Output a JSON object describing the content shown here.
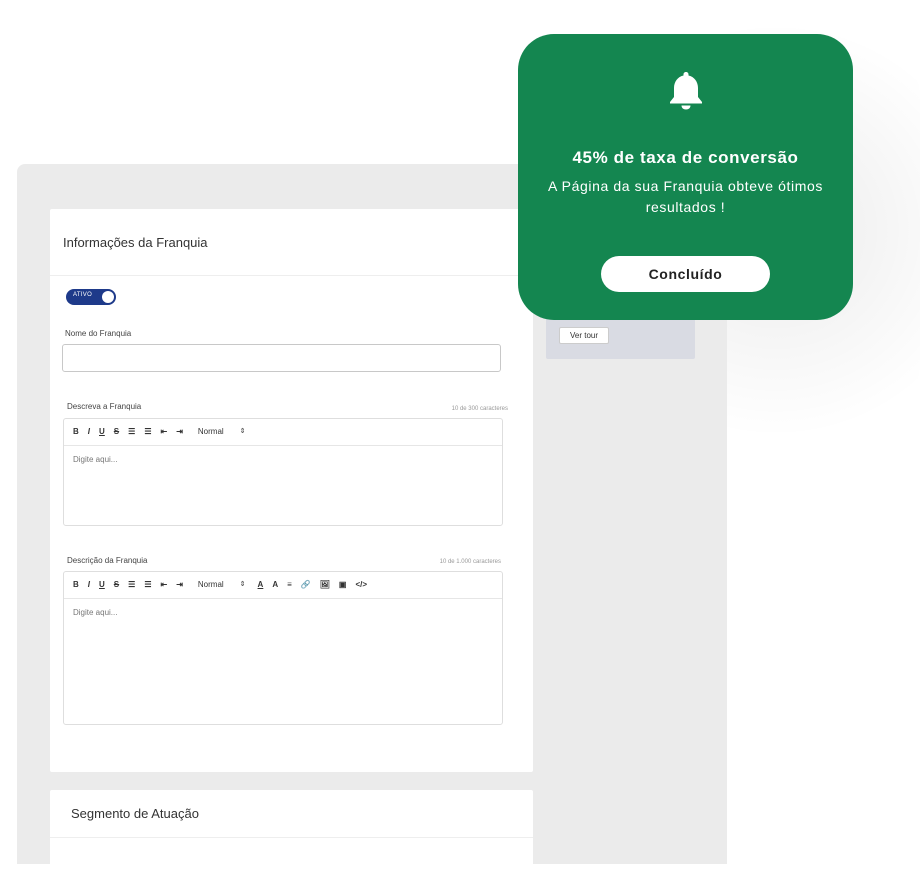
{
  "popup": {
    "title": "45% de taxa de conversão",
    "message": "A Página da sua Franquia obteve ótimos resultados !",
    "button": "Concluído",
    "icon": "bell-icon",
    "bg_color": "#148650"
  },
  "section": {
    "title": "Informações da Franquia",
    "toggle_label": "ATIVO"
  },
  "fields": {
    "nome": {
      "label": "Nome do Franquia",
      "value": ""
    },
    "descreva": {
      "label": "Descreva a Franquia",
      "count": "10 de 300 caracteres",
      "placeholder": "Digite aqui...",
      "toolbar": [
        "B",
        "I",
        "U",
        "S",
        "☰",
        "☰",
        "⇤",
        "⇥",
        "Normal",
        "⇕"
      ]
    },
    "descricao": {
      "label": "Descrição da Franquia",
      "count": "10 de  1.000 caracteres",
      "placeholder": "Digite aqui...",
      "toolbar": [
        "B",
        "I",
        "U",
        "S",
        "☰",
        "☰",
        "⇤",
        "⇥",
        "Normal",
        "⇕",
        "A",
        "A",
        "≡",
        "🔗",
        "🖼",
        "▣",
        "</>"
      ]
    }
  },
  "side": {
    "tour_button": "Ver tour"
  },
  "segment": {
    "title": "Segmento de Atuação"
  }
}
